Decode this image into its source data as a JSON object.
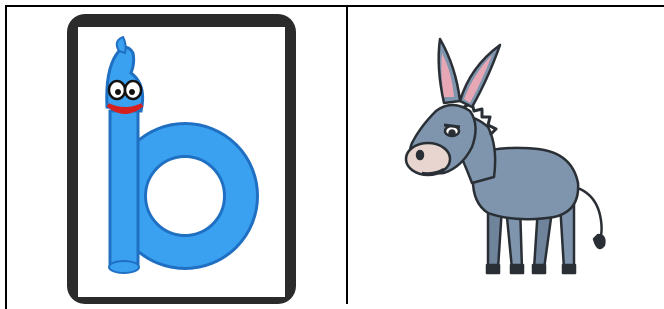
{
  "cards": [
    {
      "picture": "letter-b-character-icon",
      "letter": "b",
      "colors": {
        "frame": "#2b2b2b",
        "letter_fill": "#3aa0f0",
        "letter_outline": "#1f6fc2",
        "mouth": "#d62020"
      }
    },
    {
      "picture": "donkey-icon",
      "colors": {
        "body": "#7e95ad",
        "muzzle": "#e8d5cf",
        "ear_inner": "#e7a7b4",
        "outline": "#2a2f36"
      }
    }
  ]
}
